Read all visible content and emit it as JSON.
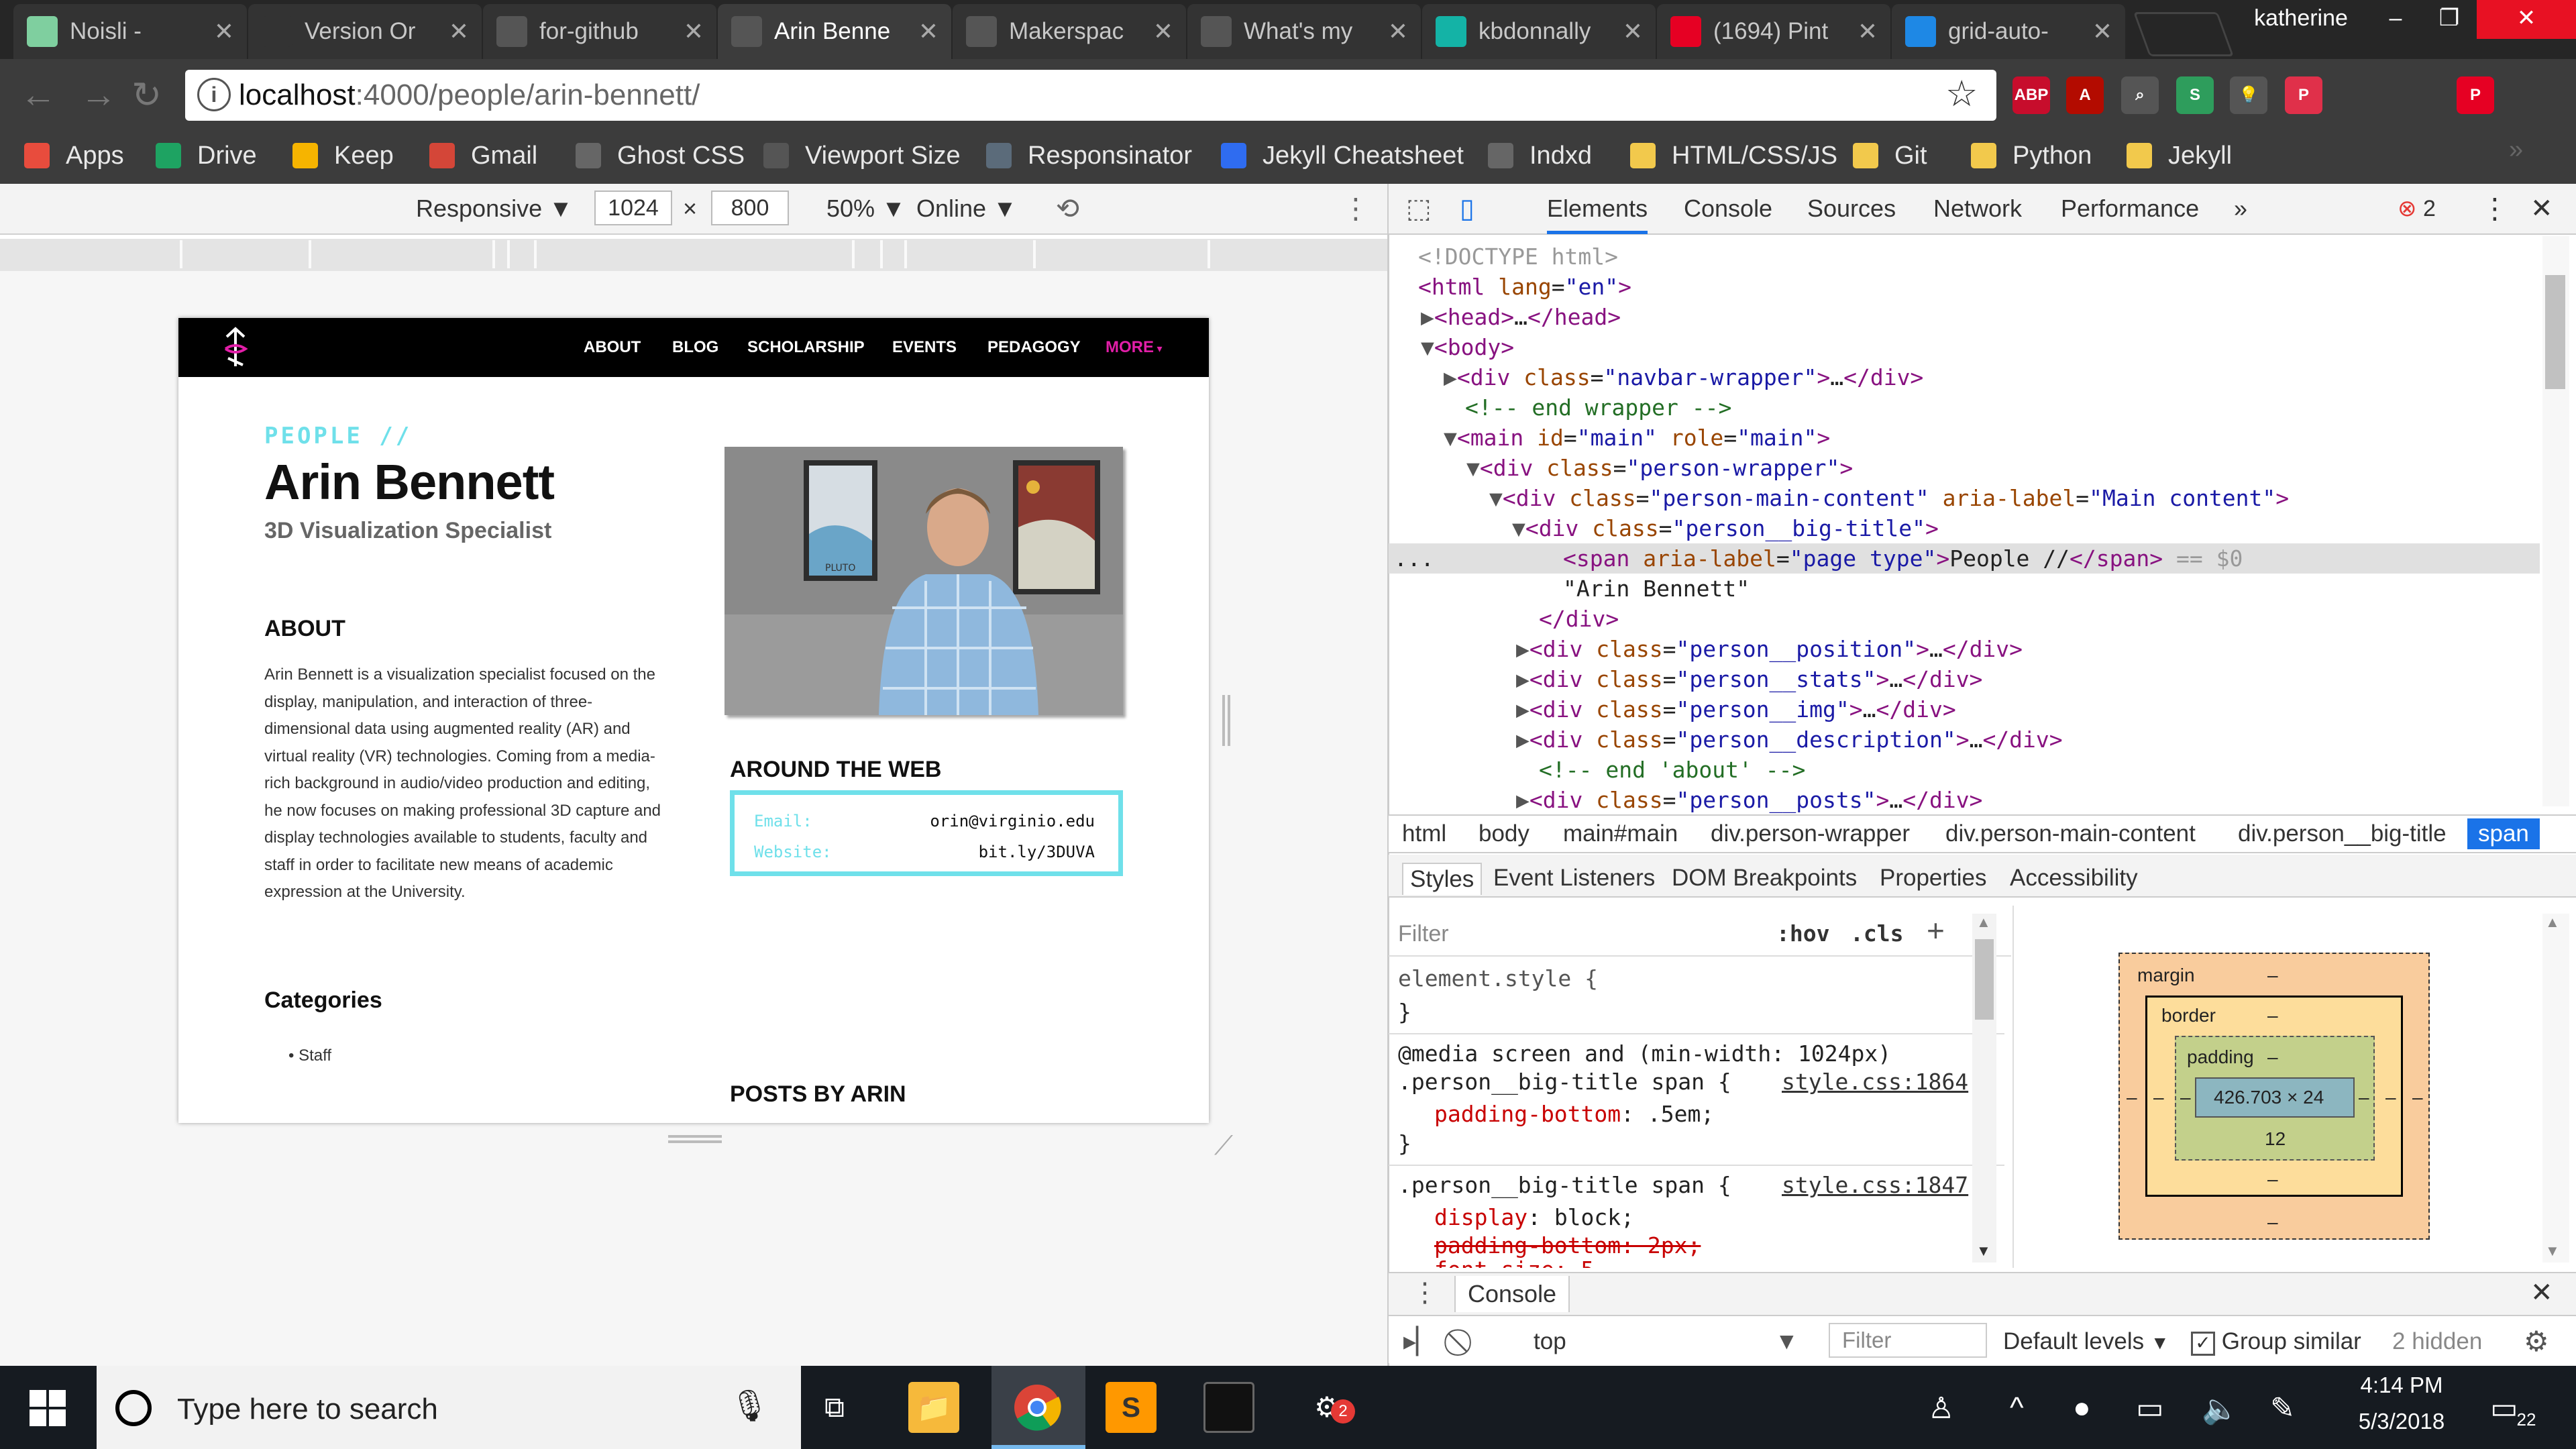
{
  "browser": {
    "tabs": [
      {
        "label": "Noisli -",
        "icon_color": "#7fcf9f"
      },
      {
        "label": "Version Or",
        "icon_color": "#333333"
      },
      {
        "label": "for-github",
        "icon_color": "#555555"
      },
      {
        "label": "Arin Benne",
        "icon_color": "#555555",
        "active": true
      },
      {
        "label": "Makerspac",
        "icon_color": "#555555"
      },
      {
        "label": "What's my",
        "icon_color": "#555555"
      },
      {
        "label": "kbdonnally",
        "icon_color": "#14b3a6"
      },
      {
        "label": "(1694) Pint",
        "icon_color": "#e60023"
      },
      {
        "label": "grid-auto-",
        "icon_color": "#1e88e5"
      }
    ],
    "profile_name": "katherine",
    "address": {
      "host": "localhost",
      "path": ":4000/people/arin-bennett/"
    },
    "extensions": [
      {
        "name": "adblock-plus-icon",
        "label": "ABP",
        "color": "#c70d2c"
      },
      {
        "name": "acrobat-icon",
        "label": "A",
        "color": "#b30b00"
      },
      {
        "name": "search-tool-icon",
        "label": "⌕",
        "color": "#555555"
      },
      {
        "name": "s-extension-icon",
        "label": "S",
        "color": "#2e9d5c"
      },
      {
        "name": "bulb-icon",
        "label": "💡",
        "color": "#555555"
      },
      {
        "name": "pocket-icon",
        "label": "P",
        "color": "#e0304a"
      },
      {
        "name": "pinterest-icon",
        "label": "P",
        "color": "#e60023"
      }
    ],
    "bookmarks": [
      {
        "label": "Apps",
        "icon": "apps-grid-icon",
        "color": "#e84c3d"
      },
      {
        "label": "Drive",
        "icon": "drive-icon",
        "color": "#1ea362"
      },
      {
        "label": "Keep",
        "icon": "keep-icon",
        "color": "#f6b400"
      },
      {
        "label": "Gmail",
        "icon": "gmail-icon",
        "color": "#d44638"
      },
      {
        "label": "Ghost CSS",
        "icon": "page-icon",
        "color": "#666666"
      },
      {
        "label": "Viewport Size",
        "icon": "viewport-icon",
        "color": "#555555"
      },
      {
        "label": "Responsinator",
        "icon": "responsinator-icon",
        "color": "#5b6b7a"
      },
      {
        "label": "Jekyll Cheatsheet",
        "icon": "jekyll-icon",
        "color": "#2f6cf0"
      },
      {
        "label": "Indxd",
        "icon": "page-icon",
        "color": "#666666"
      },
      {
        "label": "HTML/CSS/JS",
        "icon": "folder-icon",
        "color": "#f2c94c"
      },
      {
        "label": "Git",
        "icon": "folder-icon",
        "color": "#f2c94c"
      },
      {
        "label": "Python",
        "icon": "folder-icon",
        "color": "#f2c94c"
      },
      {
        "label": "Jekyll",
        "icon": "folder-icon",
        "color": "#f2c94c"
      }
    ]
  },
  "device_toolbar": {
    "mode": "Responsive",
    "width": "1024",
    "height": "800",
    "times": "×",
    "zoom": "50%",
    "network": "Online"
  },
  "site": {
    "nav": [
      "ABOUT",
      "BLOG",
      "SCHOLARSHIP",
      "EVENTS",
      "PEDAGOGY",
      "MORE"
    ],
    "eyebrow": "PEOPLE //",
    "name": "Arin Bennett",
    "position": "3D Visualization Specialist",
    "about_heading": "ABOUT",
    "about_text": "Arin Bennett is a visualization specialist focused on the display, manipulation, and interaction of three-dimensional data using augmented reality (AR) and virtual reality (VR) technologies. Coming from a media-rich background in audio/video production and editing, he now focuses on making professional 3D capture and display technologies available to students, faculty and staff in order to facilitate new means of academic expression at the University.",
    "categories_heading": "Categories",
    "category": "Staff",
    "web_heading": "AROUND THE WEB",
    "email_label": "Email:",
    "email": "orin@virginio.edu",
    "website_label": "Website:",
    "website": "bit.ly/3DUVA",
    "posts_heading": "POSTS BY ARIN",
    "poster_left": "PLUTO",
    "accent": "#6fe0ea",
    "more_color": "#e21ea8"
  },
  "devtools": {
    "tabs": [
      "Elements",
      "Console",
      "Sources",
      "Network",
      "Performance",
      "»"
    ],
    "error_count": "2",
    "dom": {
      "doctype": "<!DOCTYPE html>",
      "html_open": "html",
      "lang_attr": "lang",
      "lang_val": "\"en\"",
      "head": "head",
      "head_close": "</head>",
      "body": "body",
      "div": "div",
      "class": "class",
      "navbar": "\"navbar-wrapper\"",
      "close_div": "</div>",
      "ellipsis": "…",
      "comment_end_wrapper": "<!-- end wrapper -->",
      "main": "main",
      "id_attr": "id",
      "id_val": "\"main\"",
      "role_attr": "role",
      "role_val": "\"main\"",
      "person_wrapper": "\"person-wrapper\"",
      "person_main": "\"person-main-content\"",
      "aria_attr": "aria-label",
      "aria_main": "\"Main content\"",
      "big_title": "\"person__big-title\"",
      "span": "span",
      "aria_page_type": "\"page type\"",
      "span_text": "People //",
      "span_close": "</span>",
      "dollar0": " == $0",
      "text_node": "\"Arin Bennett\"",
      "pos_class": "\"person__position\"",
      "stats_class": "\"person__stats\"",
      "img_class": "\"person__img\"",
      "desc_class": "\"person__description\"",
      "comment_about": "<!-- end 'about' -->",
      "posts_class": "\"person__posts\"",
      "row_dots": "..."
    },
    "breadcrumbs": [
      "html",
      "body",
      "main#main",
      "div.person-wrapper",
      "div.person-main-content",
      "div.person__big-title",
      "span"
    ],
    "subtabs": [
      "Styles",
      "Event Listeners",
      "DOM Breakpoints",
      "Properties",
      "Accessibility"
    ],
    "filter_placeholder": "Filter",
    "hov": ":hov",
    "cls": ".cls",
    "styles": {
      "element_style": "element.style {",
      "close": "}",
      "media": "@media screen and (min-width: 1024px)",
      "rule1_selector": ".person__big-title span {",
      "rule1_source": "style.css:1864",
      "rule1_prop": "padding-bottom",
      "rule1_val": ": .5em;",
      "rule2_selector": ".person__big-title span {",
      "rule2_source": "style.css:1847",
      "rule2_prop1": "display",
      "rule2_val1": ": block;",
      "rule2_struck": "padding-bottom: 2px;",
      "rule2_cut": "font-size: 5"
    },
    "box_model": {
      "margin_label": "margin",
      "border_label": "border",
      "padding_label": "padding",
      "dash": "–",
      "content": "426.703 × 24",
      "padding_bottom": "12"
    },
    "console": {
      "tab": "Console",
      "context": "top",
      "filter_placeholder": "Filter",
      "levels": "Default levels",
      "group_similar": "Group similar",
      "hidden": "2 hidden"
    }
  },
  "taskbar": {
    "search_placeholder": "Type here to search",
    "time": "4:14 PM",
    "date": "5/3/2018",
    "notifications": "22",
    "badge": "2"
  }
}
